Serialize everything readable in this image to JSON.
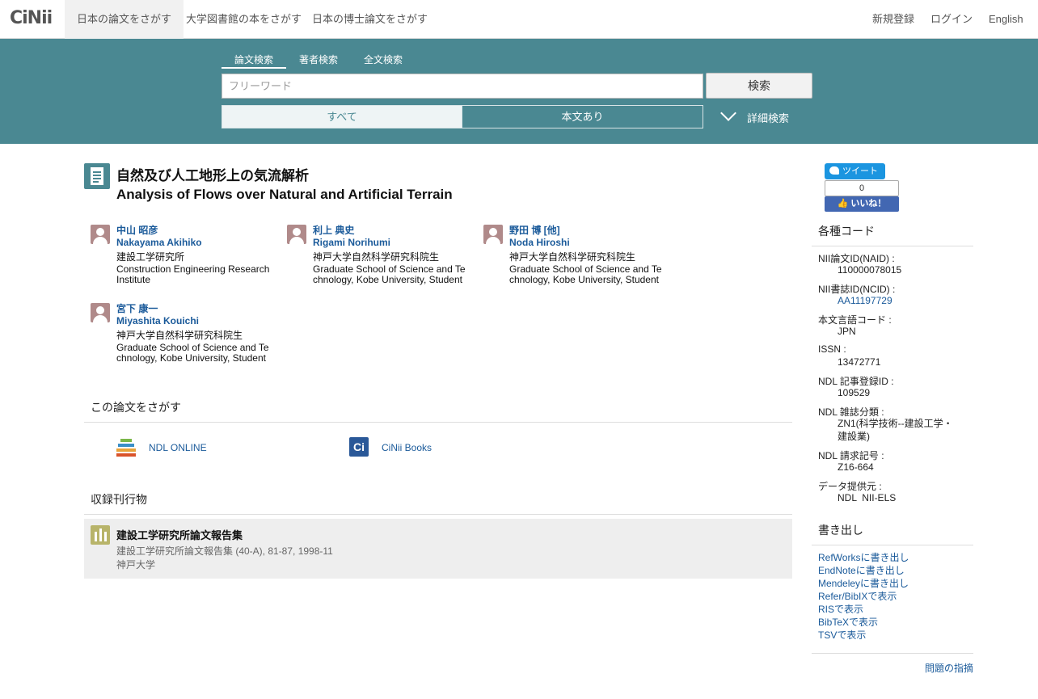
{
  "nav": {
    "logo": "CiNii",
    "tabs": [
      "日本の論文をさがす",
      "大学図書館の本をさがす",
      "日本の博士論文をさがす"
    ],
    "right": [
      "新規登録",
      "ログイン",
      "English"
    ]
  },
  "search": {
    "tabs": [
      "論文検索",
      "著者検索",
      "全文検索"
    ],
    "placeholder": "フリーワード",
    "button": "検索",
    "filters": [
      "すべて",
      "本文あり"
    ],
    "advanced": "詳細検索"
  },
  "article": {
    "title_jp": "自然及び人工地形上の気流解析",
    "title_en": "Analysis of Flows over Natural and Artificial Terrain"
  },
  "authors": [
    {
      "name_jp": "中山 昭彦",
      "name_en": "Nakayama Akihiko",
      "affil_jp": "建設工学研究所",
      "affil_en": "Construction Engineering Research Institute"
    },
    {
      "name_jp": "利上 典史",
      "name_en": "Rigami Norihumi",
      "affil_jp": "神戸大学自然科学研究科院生",
      "affil_en": "Graduate School of Science and Technology, Kobe University, Student"
    },
    {
      "name_jp": "野田 博 [他]",
      "name_en": "Noda Hiroshi",
      "affil_jp": "神戸大学自然科学研究科院生",
      "affil_en": "Graduate School of Science and Technology, Kobe University, Student"
    },
    {
      "name_jp": "宮下 康一",
      "name_en": "Miyashita Kouichi",
      "affil_jp": "神戸大学自然科学研究科院生",
      "affil_en": "Graduate School of Science and Technology, Kobe University, Student"
    }
  ],
  "find_section": {
    "heading": "この論文をさがす",
    "links": [
      "NDL ONLINE",
      "CiNii Books"
    ]
  },
  "journal_section": {
    "heading": "収録刊行物",
    "title": "建設工学研究所論文報告集",
    "meta": "建設工学研究所論文報告集 (40-A), 81-87, 1998-11",
    "publisher": "神戸大学"
  },
  "social": {
    "tweet": "ツイート",
    "fb_count": "0",
    "fb_like": "いいね！"
  },
  "codes": {
    "heading": "各種コード",
    "items": [
      {
        "label": "NII論文ID(NAID) :",
        "value": "110000078015"
      },
      {
        "label": "NII書誌ID(NCID) :",
        "value": "AA11197729"
      },
      {
        "label": "本文言語コード :",
        "value": "JPN"
      },
      {
        "label": "ISSN :",
        "value": "13472771"
      },
      {
        "label": "NDL 記事登録ID :",
        "value": "109529"
      },
      {
        "label": "NDL 雑誌分類 :",
        "value": "ZN1(科学技術--建設工学・建設業)"
      },
      {
        "label": "NDL 請求記号 :",
        "value": "Z16-664"
      },
      {
        "label": "データ提供元 :",
        "value": "NDL  NII-ELS"
      }
    ]
  },
  "export": {
    "heading": "書き出し",
    "items": [
      "RefWorksに書き出し",
      "EndNoteに書き出し",
      "Mendeleyに書き出し",
      "Refer/BibIXで表示",
      "RISで表示",
      "BibTeXで表示",
      "TSVで表示"
    ]
  },
  "report": "問題の指摘"
}
